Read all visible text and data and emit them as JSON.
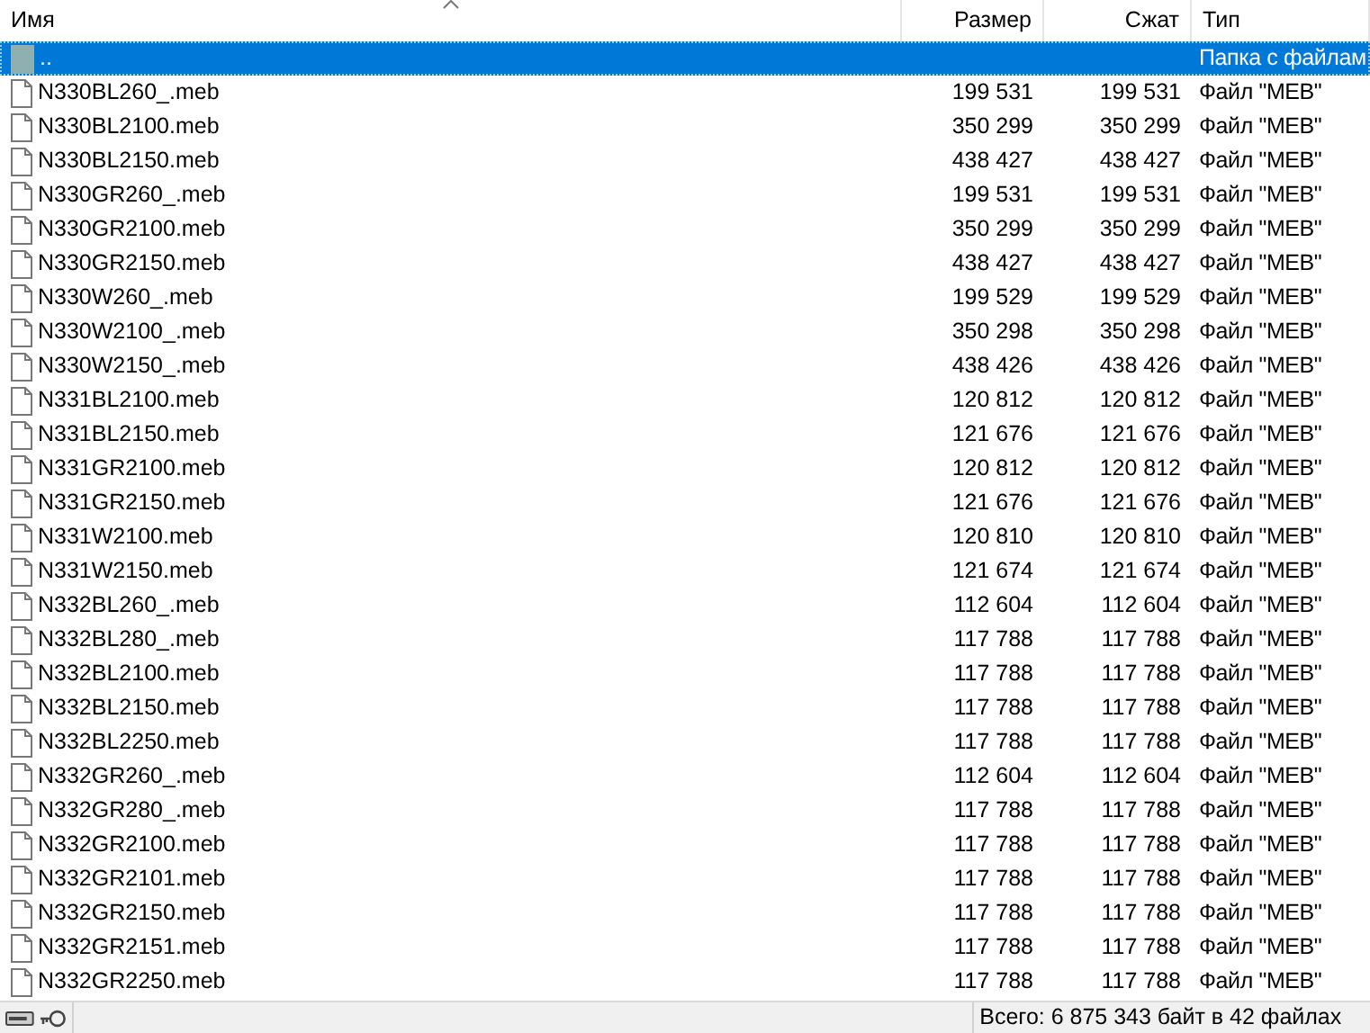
{
  "columns": [
    {
      "label": "Имя",
      "sorted": true
    },
    {
      "label": "Размер",
      "sorted": false
    },
    {
      "label": "Сжат",
      "sorted": false
    },
    {
      "label": "Тип",
      "sorted": false
    }
  ],
  "rows": [
    {
      "kind": "parent",
      "name": "..",
      "size": "",
      "packed": "",
      "type": "Папка с файлам",
      "selected": true
    },
    {
      "kind": "file",
      "name": "N330BL260_.meb",
      "size": "199 531",
      "packed": "199 531",
      "type": "Файл \"MEB\"",
      "selected": false
    },
    {
      "kind": "file",
      "name": "N330BL2100.meb",
      "size": "350 299",
      "packed": "350 299",
      "type": "Файл \"MEB\"",
      "selected": false
    },
    {
      "kind": "file",
      "name": "N330BL2150.meb",
      "size": "438 427",
      "packed": "438 427",
      "type": "Файл \"MEB\"",
      "selected": false
    },
    {
      "kind": "file",
      "name": "N330GR260_.meb",
      "size": "199 531",
      "packed": "199 531",
      "type": "Файл \"MEB\"",
      "selected": false
    },
    {
      "kind": "file",
      "name": "N330GR2100.meb",
      "size": "350 299",
      "packed": "350 299",
      "type": "Файл \"MEB\"",
      "selected": false
    },
    {
      "kind": "file",
      "name": "N330GR2150.meb",
      "size": "438 427",
      "packed": "438 427",
      "type": "Файл \"MEB\"",
      "selected": false
    },
    {
      "kind": "file",
      "name": "N330W260_.meb",
      "size": "199 529",
      "packed": "199 529",
      "type": "Файл \"MEB\"",
      "selected": false
    },
    {
      "kind": "file",
      "name": "N330W2100_.meb",
      "size": "350 298",
      "packed": "350 298",
      "type": "Файл \"MEB\"",
      "selected": false
    },
    {
      "kind": "file",
      "name": "N330W2150_.meb",
      "size": "438 426",
      "packed": "438 426",
      "type": "Файл \"MEB\"",
      "selected": false
    },
    {
      "kind": "file",
      "name": "N331BL2100.meb",
      "size": "120 812",
      "packed": "120 812",
      "type": "Файл \"MEB\"",
      "selected": false
    },
    {
      "kind": "file",
      "name": "N331BL2150.meb",
      "size": "121 676",
      "packed": "121 676",
      "type": "Файл \"MEB\"",
      "selected": false
    },
    {
      "kind": "file",
      "name": "N331GR2100.meb",
      "size": "120 812",
      "packed": "120 812",
      "type": "Файл \"MEB\"",
      "selected": false
    },
    {
      "kind": "file",
      "name": "N331GR2150.meb",
      "size": "121 676",
      "packed": "121 676",
      "type": "Файл \"MEB\"",
      "selected": false
    },
    {
      "kind": "file",
      "name": "N331W2100.meb",
      "size": "120 810",
      "packed": "120 810",
      "type": "Файл \"MEB\"",
      "selected": false
    },
    {
      "kind": "file",
      "name": "N331W2150.meb",
      "size": "121 674",
      "packed": "121 674",
      "type": "Файл \"MEB\"",
      "selected": false
    },
    {
      "kind": "file",
      "name": "N332BL260_.meb",
      "size": "112 604",
      "packed": "112 604",
      "type": "Файл \"MEB\"",
      "selected": false
    },
    {
      "kind": "file",
      "name": "N332BL280_.meb",
      "size": "117 788",
      "packed": "117 788",
      "type": "Файл \"MEB\"",
      "selected": false
    },
    {
      "kind": "file",
      "name": "N332BL2100.meb",
      "size": "117 788",
      "packed": "117 788",
      "type": "Файл \"MEB\"",
      "selected": false
    },
    {
      "kind": "file",
      "name": "N332BL2150.meb",
      "size": "117 788",
      "packed": "117 788",
      "type": "Файл \"MEB\"",
      "selected": false
    },
    {
      "kind": "file",
      "name": "N332BL2250.meb",
      "size": "117 788",
      "packed": "117 788",
      "type": "Файл \"MEB\"",
      "selected": false
    },
    {
      "kind": "file",
      "name": "N332GR260_.meb",
      "size": "112 604",
      "packed": "112 604",
      "type": "Файл \"MEB\"",
      "selected": false
    },
    {
      "kind": "file",
      "name": "N332GR280_.meb",
      "size": "117 788",
      "packed": "117 788",
      "type": "Файл \"MEB\"",
      "selected": false
    },
    {
      "kind": "file",
      "name": "N332GR2100.meb",
      "size": "117 788",
      "packed": "117 788",
      "type": "Файл \"MEB\"",
      "selected": false
    },
    {
      "kind": "file",
      "name": "N332GR2101.meb",
      "size": "117 788",
      "packed": "117 788",
      "type": "Файл \"MEB\"",
      "selected": false
    },
    {
      "kind": "file",
      "name": "N332GR2150.meb",
      "size": "117 788",
      "packed": "117 788",
      "type": "Файл \"MEB\"",
      "selected": false
    },
    {
      "kind": "file",
      "name": "N332GR2151.meb",
      "size": "117 788",
      "packed": "117 788",
      "type": "Файл \"MEB\"",
      "selected": false
    },
    {
      "kind": "file",
      "name": "N332GR2250.meb",
      "size": "117 788",
      "packed": "117 788",
      "type": "Файл \"MEB\"",
      "selected": false
    }
  ],
  "status_bar": {
    "summary": "Всего: 6 875 343 байт в 42 файлах"
  }
}
